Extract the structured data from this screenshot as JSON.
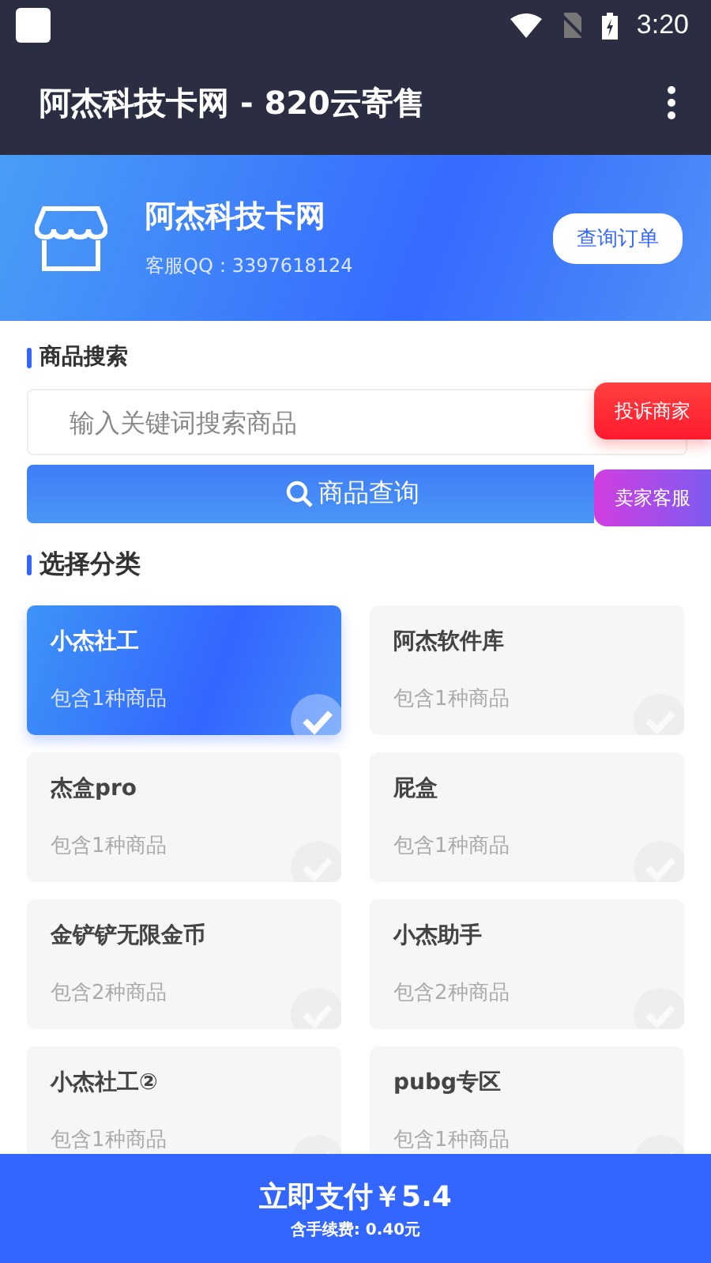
{
  "status_bar": {
    "time": "3:20"
  },
  "app_bar": {
    "title": "阿杰科技卡网 - 820云寄售"
  },
  "shop": {
    "name": "阿杰科技卡网",
    "contact": "客服QQ：3397618124",
    "order_button": "查询订单"
  },
  "search": {
    "heading": "商品搜索",
    "placeholder": "输入关键词搜索商品",
    "button": "商品查询"
  },
  "floating_buttons": [
    {
      "label": "投诉商家",
      "kind": "complain"
    },
    {
      "label": "卖家客服",
      "kind": "service"
    }
  ],
  "categories": {
    "heading": "选择分类",
    "items": [
      {
        "name": "小杰社工",
        "count": "包含1种商品",
        "selected": true
      },
      {
        "name": "阿杰软件库",
        "count": "包含1种商品",
        "selected": false
      },
      {
        "name": "杰盒pro",
        "count": "包含1种商品",
        "selected": false
      },
      {
        "name": "屁盒",
        "count": "包含1种商品",
        "selected": false
      },
      {
        "name": "金铲铲无限金币",
        "count": "包含2种商品",
        "selected": false
      },
      {
        "name": "小杰助手",
        "count": "包含2种商品",
        "selected": false
      },
      {
        "name": "小杰社工②",
        "count": "包含1种商品",
        "selected": false
      },
      {
        "name": "pubg专区",
        "count": "包含1种商品",
        "selected": false
      }
    ]
  },
  "pay_bar": {
    "button": "立即支付￥5.4",
    "fee": "含手续费: 0.40元"
  }
}
